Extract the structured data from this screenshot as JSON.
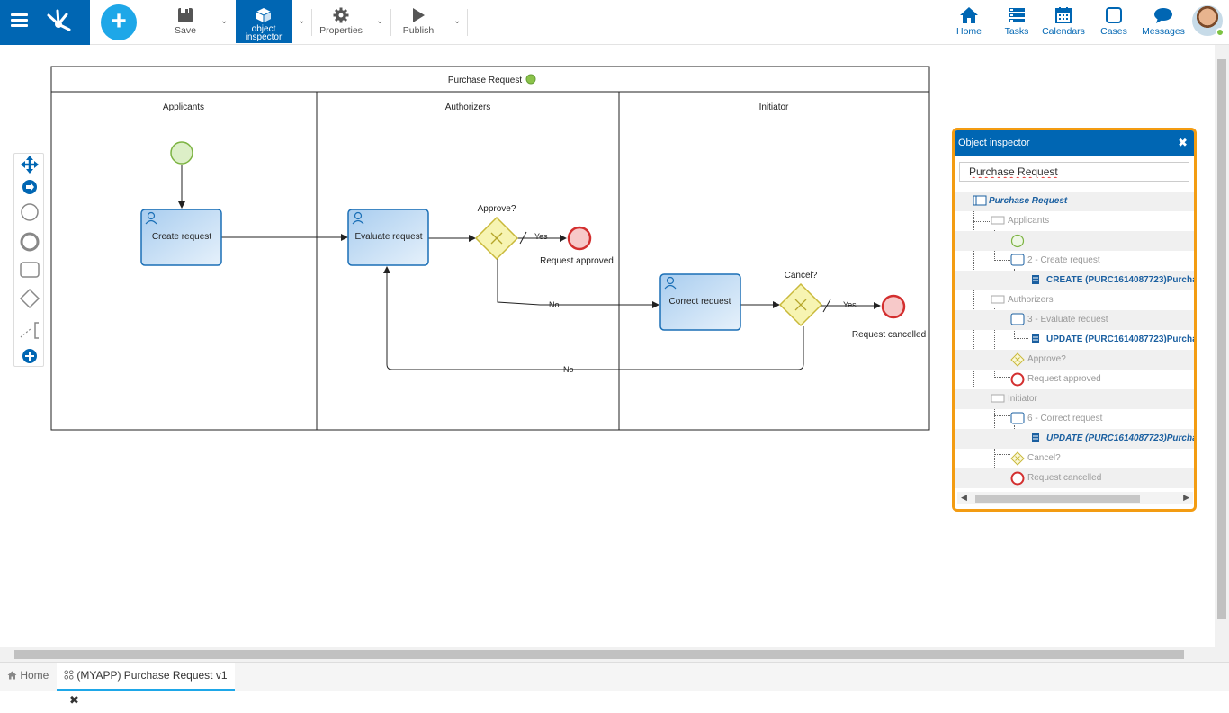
{
  "toolbar": {
    "save_label": "Save",
    "inspector_label_1": "object",
    "inspector_label_2": "inspector",
    "properties_label": "Properties",
    "publish_label": "Publish"
  },
  "nav": {
    "home": "Home",
    "tasks": "Tasks",
    "calendars": "Calendars",
    "cases": "Cases",
    "messages": "Messages"
  },
  "diagram": {
    "pool_title": "Purchase Request",
    "lanes": [
      "Applicants",
      "Authorizers",
      "Initiator"
    ],
    "tasks": {
      "create": "Create request",
      "evaluate": "Evaluate request",
      "correct": "Correct request"
    },
    "gateways": {
      "approve": "Approve?",
      "cancel": "Cancel?"
    },
    "flows": {
      "yes1": "Yes",
      "no1": "No",
      "yes2": "Yes",
      "no2": "No"
    },
    "events": {
      "approved": "Request approved",
      "cancelled": "Request cancelled"
    }
  },
  "inspector": {
    "title": "Object inspector",
    "search_value": "Purchase Request",
    "tree": [
      "Purchase Request",
      "Applicants",
      "",
      "2 - Create request",
      "CREATE (PURC1614087723)Purcha",
      "Authorizers",
      "3 - Evaluate request",
      "UPDATE (PURC1614087723)Purcha",
      "Approve?",
      "Request approved",
      "Initiator",
      "6 - Correct request",
      "UPDATE (PURC1614087723)Purcha",
      "Cancel?",
      "Request cancelled"
    ]
  },
  "tabs": {
    "home": "Home",
    "active": "(MYAPP) Purchase Request v1"
  },
  "colors": {
    "brand": "#0066b3",
    "accent": "#1ea7e8",
    "highlight": "#f39c12"
  }
}
